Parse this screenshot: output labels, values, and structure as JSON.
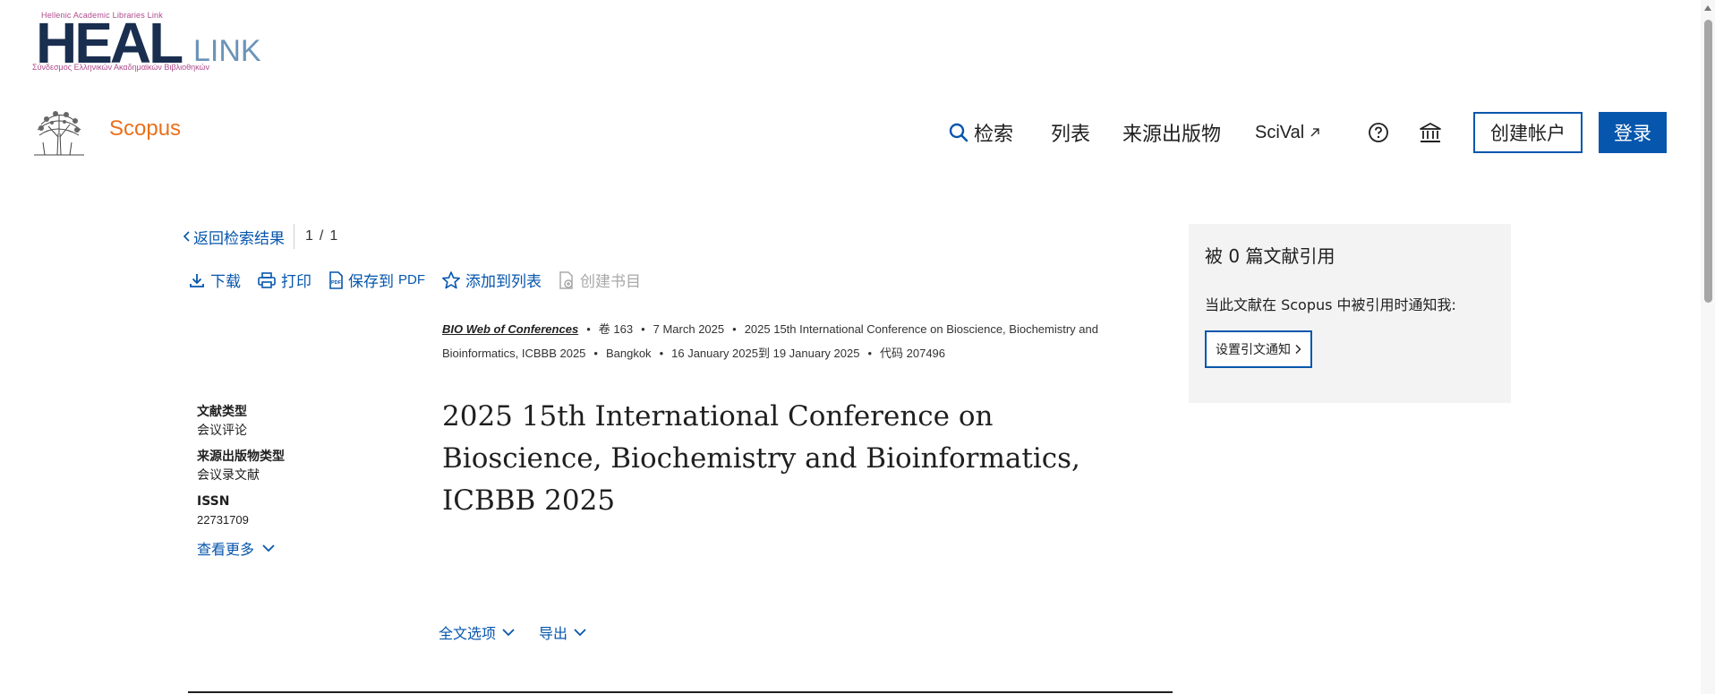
{
  "logo": {
    "top_text": "Hellenic Academic Libraries Link",
    "heal": "HEAL",
    "link": "LINK",
    "bottom_text": "Σύνδεσμος Ελληνικών Ακαδημαϊκών Βιβλιοθηκών"
  },
  "header": {
    "brand": "Scopus",
    "nav": {
      "search": "检索",
      "lists": "列表",
      "sources": "来源出版物",
      "scival": "SciVal"
    },
    "create_account": "创建帐户",
    "login": "登录"
  },
  "nav_back": {
    "label": "返回检索结果",
    "page_current": "1",
    "page_sep": "/",
    "page_total": "1"
  },
  "toolbar": {
    "download": "下载",
    "print": "打印",
    "save_pdf_prefix": "保存到",
    "save_pdf_suffix": "PDF",
    "add_to_list": "添加到列表",
    "create_bib": "创建书目"
  },
  "meta": {
    "journal": "BIO Web of Conferences",
    "volume": "卷 163",
    "date": "7 March 2025",
    "conference": "2025 15th International Conference on Bioscience, Biochemistry and Bioinformatics, ICBBB 2025",
    "location": "Bangkok",
    "conf_dates": "16 January 2025到 19 January 2025",
    "code": "代码 207496"
  },
  "side_info": {
    "doc_type_label": "文献类型",
    "doc_type_value": "会议评论",
    "source_type_label": "来源出版物类型",
    "source_type_value": "会议录文献",
    "issn_label": "ISSN",
    "issn_value": "22731709",
    "see_more": "查看更多"
  },
  "title": "2025 15th International Conference on Bioscience, Biochemistry and Bioinformatics, ICBBB 2025",
  "options": {
    "full_text": "全文选项",
    "export": "导出"
  },
  "cited": {
    "title": "被 0 篇文献引用",
    "note": "当此文献在 Scopus 中被引用时通知我:",
    "button": "设置引文通知"
  },
  "colors": {
    "accent": "#0656ad",
    "brand": "#e9711c",
    "panel": "#f3f3f3"
  }
}
